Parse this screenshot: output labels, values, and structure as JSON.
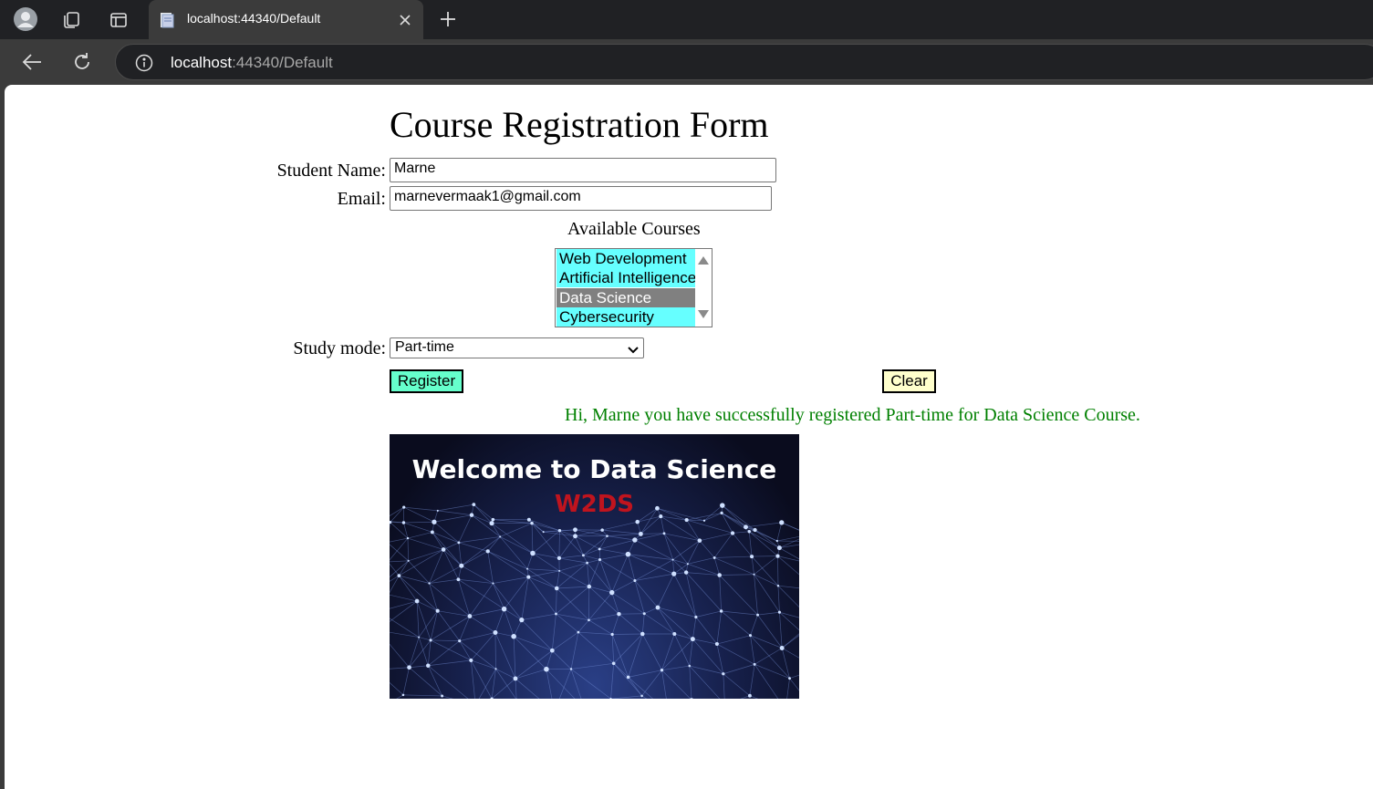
{
  "browser": {
    "tab_title": "localhost:44340/Default",
    "url_host": "localhost",
    "url_rest": ":44340/Default"
  },
  "form": {
    "title": "Course Registration Form",
    "student_name_label": "Student Name:",
    "student_name_value": "Marne",
    "email_label": "Email:",
    "email_value": "marnevermaak1@gmail.com",
    "courses_label": "Available Courses",
    "courses": [
      {
        "label": "Web Development",
        "selected": false
      },
      {
        "label": "Artificial Intelligence",
        "selected": false
      },
      {
        "label": "Data Science",
        "selected": true
      },
      {
        "label": "Cybersecurity",
        "selected": false
      }
    ],
    "study_mode_label": "Study mode:",
    "study_mode_value": "Part-time",
    "register_label": "Register",
    "clear_label": "Clear",
    "success_message": "Hi, Marne you have successfully registered Part-time for Data Science Course."
  },
  "banner": {
    "title": "Welcome to Data Science",
    "subtitle": "W2DS"
  },
  "colors": {
    "option_bg": "#66ffff",
    "option_selected_bg": "#808080",
    "register_bg": "#66ffcc",
    "clear_bg": "#ffffcc",
    "success_text": "#008000",
    "banner_subtitle": "#c0141e"
  }
}
